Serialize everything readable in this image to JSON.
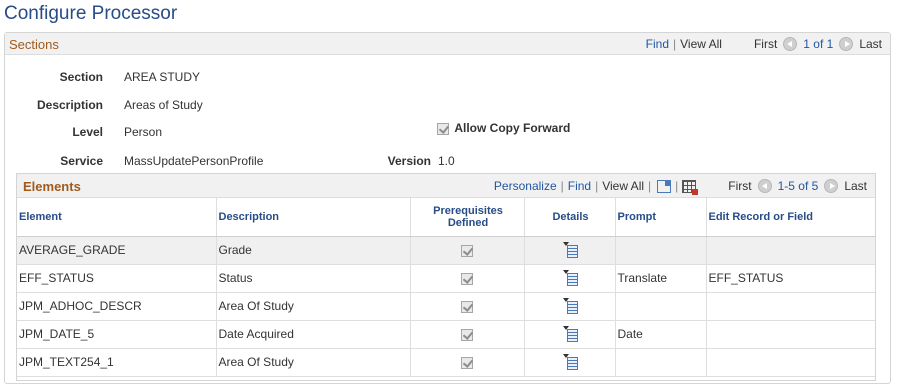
{
  "page": {
    "title": "Configure Processor"
  },
  "sections": {
    "title": "Sections",
    "nav": {
      "find": "Find",
      "view_all": "View All",
      "first": "First",
      "range": "1 of 1",
      "last": "Last"
    },
    "fields": {
      "section_label": "Section",
      "section_value": "AREA STUDY",
      "description_label": "Description",
      "description_value": "Areas of Study",
      "level_label": "Level",
      "level_value": "Person",
      "allow_copy_forward_label": "Allow Copy Forward",
      "allow_copy_forward_checked": true,
      "service_label": "Service",
      "service_value": "MassUpdatePersonProfile",
      "version_label": "Version",
      "version_value": "1.0"
    }
  },
  "elements": {
    "title": "Elements",
    "nav": {
      "personalize": "Personalize",
      "find": "Find",
      "view_all": "View All",
      "first": "First",
      "range": "1-5 of 5",
      "last": "Last"
    },
    "columns": {
      "element": "Element",
      "description": "Description",
      "prerequisites": "Prerequisites Defined",
      "details": "Details",
      "prompt": "Prompt",
      "edit_record": "Edit Record or Field"
    },
    "rows": [
      {
        "element": "AVERAGE_GRADE",
        "description": "Grade",
        "prerequisites": true,
        "prompt": "",
        "edit_record": ""
      },
      {
        "element": "EFF_STATUS",
        "description": "Status",
        "prerequisites": true,
        "prompt": "Translate",
        "edit_record": "EFF_STATUS"
      },
      {
        "element": "JPM_ADHOC_DESCR",
        "description": "Area Of Study",
        "prerequisites": true,
        "prompt": "",
        "edit_record": ""
      },
      {
        "element": "JPM_DATE_5",
        "description": "Date Acquired",
        "prerequisites": true,
        "prompt": "Date",
        "edit_record": ""
      },
      {
        "element": "JPM_TEXT254_1",
        "description": "Area Of Study",
        "prerequisites": true,
        "prompt": "",
        "edit_record": ""
      }
    ]
  },
  "icons": {
    "nav_prev": "chevron-left-icon",
    "nav_next": "chevron-right-icon",
    "zoom": "zoom-icon",
    "download": "grid-download-icon",
    "details": "details-icon",
    "checkbox": "checkbox-icon"
  }
}
